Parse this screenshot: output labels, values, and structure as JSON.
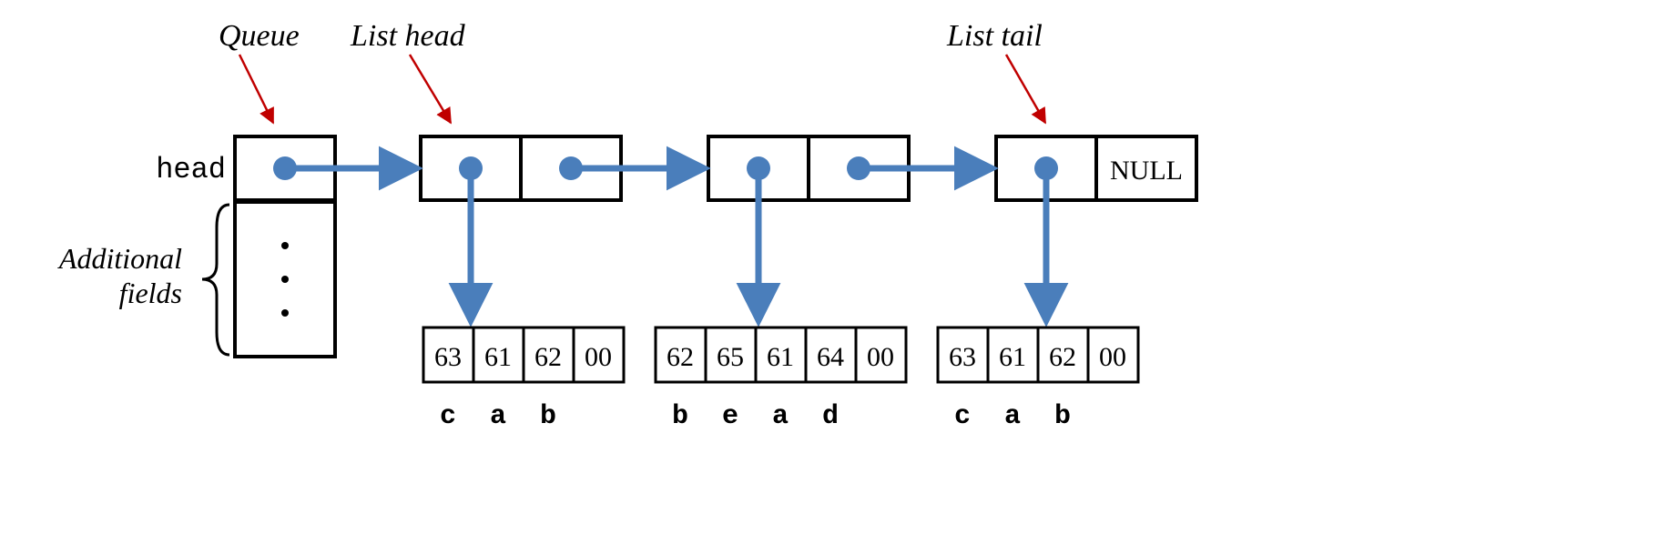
{
  "labels": {
    "queue": "Queue",
    "list_head": "List head",
    "list_tail": "List tail",
    "head_field": "head",
    "additional_fields_line1": "Additional",
    "additional_fields_line2": "fields",
    "null_text": "NULL"
  },
  "nodes": [
    {
      "bytes": [
        "63",
        "61",
        "62",
        "00"
      ],
      "chars": [
        "c",
        "a",
        "b",
        ""
      ]
    },
    {
      "bytes": [
        "62",
        "65",
        "61",
        "64",
        "00"
      ],
      "chars": [
        "b",
        "e",
        "a",
        "d",
        ""
      ]
    },
    {
      "bytes": [
        "63",
        "61",
        "62",
        "00"
      ],
      "chars": [
        "c",
        "a",
        "b",
        ""
      ]
    }
  ]
}
